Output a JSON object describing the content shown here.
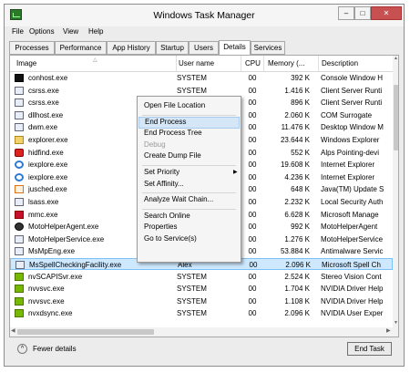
{
  "window": {
    "title": "Windows Task Manager"
  },
  "menubar": [
    "File",
    "Options",
    "View",
    "Help"
  ],
  "tabs": [
    "Processes",
    "Performance",
    "App History",
    "Startup",
    "Users",
    "Details",
    "Services"
  ],
  "active_tab": "Details",
  "columns": {
    "image": "Image",
    "user": "User name",
    "cpu": "CPU",
    "memory": "Memory (...",
    "description": "Description"
  },
  "rows": [
    {
      "image": "conhost.exe",
      "user": "SYSTEM",
      "cpu": "00",
      "memory": "392 K",
      "description": "Console Window H",
      "icon": "console"
    },
    {
      "image": "csrss.exe",
      "user": "SYSTEM",
      "cpu": "00",
      "memory": "1.416 K",
      "description": "Client Server Runti",
      "icon": "generic"
    },
    {
      "image": "csrss.exe",
      "user": "",
      "cpu": "00",
      "memory": "896 K",
      "description": "Client Server Runti",
      "icon": "generic"
    },
    {
      "image": "dllhost.exe",
      "user": "",
      "cpu": "00",
      "memory": "2.060 K",
      "description": "COM Surrogate",
      "icon": "generic"
    },
    {
      "image": "dwm.exe",
      "user": "",
      "cpu": "00",
      "memory": "11.476 K",
      "description": "Desktop Window M",
      "icon": "generic"
    },
    {
      "image": "explorer.exe",
      "user": "",
      "cpu": "00",
      "memory": "23.644 K",
      "description": "Windows Explorer",
      "icon": "explorer"
    },
    {
      "image": "hidfind.exe",
      "user": "",
      "cpu": "00",
      "memory": "552 K",
      "description": "Alps Pointing-devi",
      "icon": "mouse"
    },
    {
      "image": "iexplore.exe",
      "user": "",
      "cpu": "00",
      "memory": "19.608 K",
      "description": "Internet Explorer",
      "icon": "ie"
    },
    {
      "image": "iexplore.exe",
      "user": "",
      "cpu": "00",
      "memory": "4.236 K",
      "description": "Internet Explorer",
      "icon": "ie"
    },
    {
      "image": "jusched.exe",
      "user": "",
      "cpu": "00",
      "memory": "648 K",
      "description": "Java(TM) Update S",
      "icon": "java"
    },
    {
      "image": "lsass.exe",
      "user": "",
      "cpu": "00",
      "memory": "2.232 K",
      "description": "Local Security Auth",
      "icon": "generic"
    },
    {
      "image": "mmc.exe",
      "user": "",
      "cpu": "00",
      "memory": "6.628 K",
      "description": "Microsoft Manage",
      "icon": "mmc"
    },
    {
      "image": "MotoHelperAgent.exe",
      "user": "",
      "cpu": "00",
      "memory": "992 K",
      "description": "MotoHelperAgent",
      "icon": "moto"
    },
    {
      "image": "MotoHelperService.exe",
      "user": "",
      "cpu": "00",
      "memory": "1.276 K",
      "description": "MotoHelperService",
      "icon": "generic"
    },
    {
      "image": "MsMpEng.exe",
      "user": "",
      "cpu": "00",
      "memory": "53.884 K",
      "description": "Antimalware Servic",
      "icon": "generic"
    },
    {
      "image": "MsSpellCheckingFacility.exe",
      "user": "Alex",
      "cpu": "00",
      "memory": "2.096 K",
      "description": "Microsoft Spell Ch",
      "icon": "generic",
      "selected": true
    },
    {
      "image": "nvSCAPISvr.exe",
      "user": "SYSTEM",
      "cpu": "00",
      "memory": "2.524 K",
      "description": "Stereo Vision Cont",
      "icon": "nvidia"
    },
    {
      "image": "nvvsvc.exe",
      "user": "SYSTEM",
      "cpu": "00",
      "memory": "1.704 K",
      "description": "NVIDIA Driver Help",
      "icon": "nvidia"
    },
    {
      "image": "nvvsvc.exe",
      "user": "SYSTEM",
      "cpu": "00",
      "memory": "1.108 K",
      "description": "NVIDIA Driver Help",
      "icon": "nvidia"
    },
    {
      "image": "nvxdsync.exe",
      "user": "SYSTEM",
      "cpu": "00",
      "memory": "2.096 K",
      "description": "NVIDIA User Exper",
      "icon": "nvidia"
    }
  ],
  "context_menu": [
    {
      "label": "Open File Location"
    },
    {
      "separator": true
    },
    {
      "label": "End Process",
      "hover": true
    },
    {
      "label": "End Process Tree"
    },
    {
      "label": "Debug",
      "disabled": true
    },
    {
      "label": "Create Dump File"
    },
    {
      "separator": true
    },
    {
      "label": "Set Priority",
      "submenu": true
    },
    {
      "label": "Set Affinity..."
    },
    {
      "separator": true
    },
    {
      "label": "Analyze Wait Chain..."
    },
    {
      "separator": true
    },
    {
      "label": "Search Online"
    },
    {
      "label": "Properties"
    },
    {
      "label": "Go to Service(s)"
    }
  ],
  "footer": {
    "fewer_details": "Fewer details",
    "end_task": "End Task"
  }
}
